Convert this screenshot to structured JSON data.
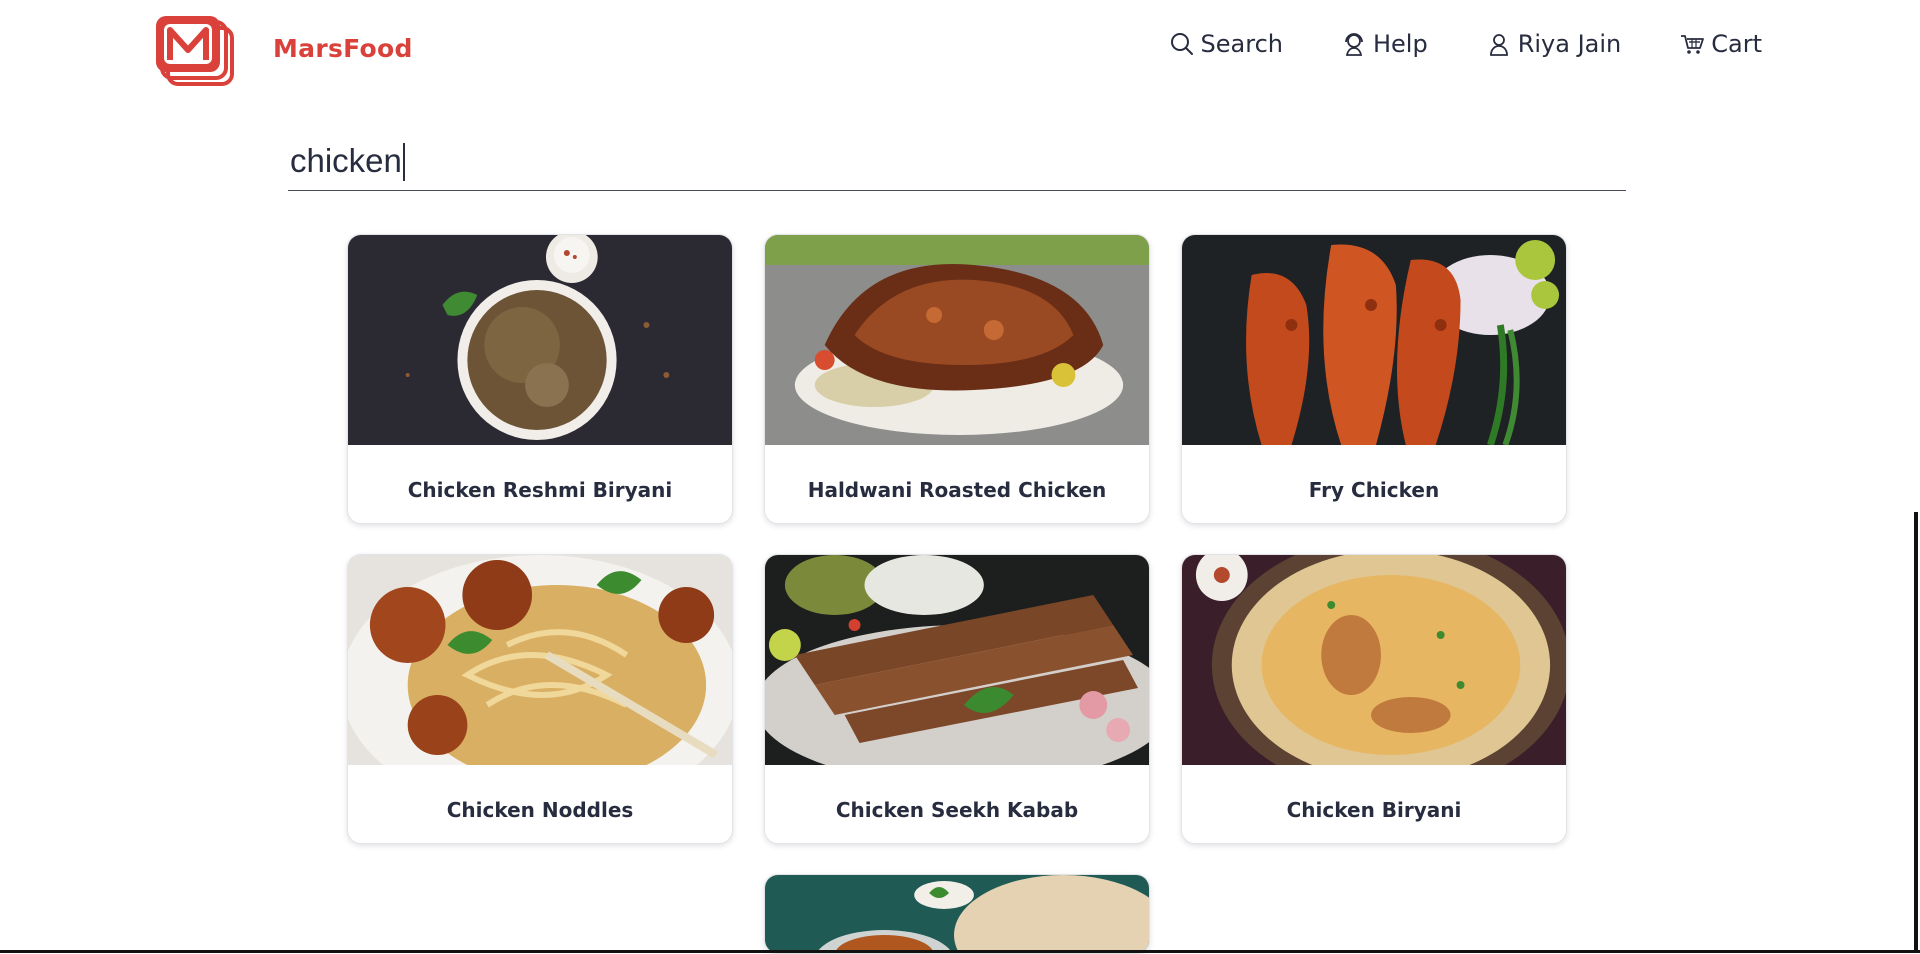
{
  "brand": {
    "name": "MarsFood",
    "logo": "mars-m-logo"
  },
  "nav": {
    "search": {
      "label": "Search",
      "icon": "search-icon"
    },
    "help": {
      "label": "Help",
      "icon": "help-support-icon"
    },
    "profile": {
      "label": "Riya Jain",
      "icon": "user-icon"
    },
    "cart": {
      "label": "Cart",
      "icon": "cart-icon"
    }
  },
  "search": {
    "value": "chicken",
    "placeholder": ""
  },
  "results": [
    {
      "name": "Chicken Reshmi Biryani"
    },
    {
      "name": "Haldwani Roasted Chicken"
    },
    {
      "name": "Fry Chicken"
    },
    {
      "name": "Chicken Noddles"
    },
    {
      "name": "Chicken Seekh Kabab"
    },
    {
      "name": "Chicken Biryani"
    },
    {
      "name": ""
    }
  ],
  "colors": {
    "brand": "#d9413a",
    "text": "#282c3f"
  }
}
